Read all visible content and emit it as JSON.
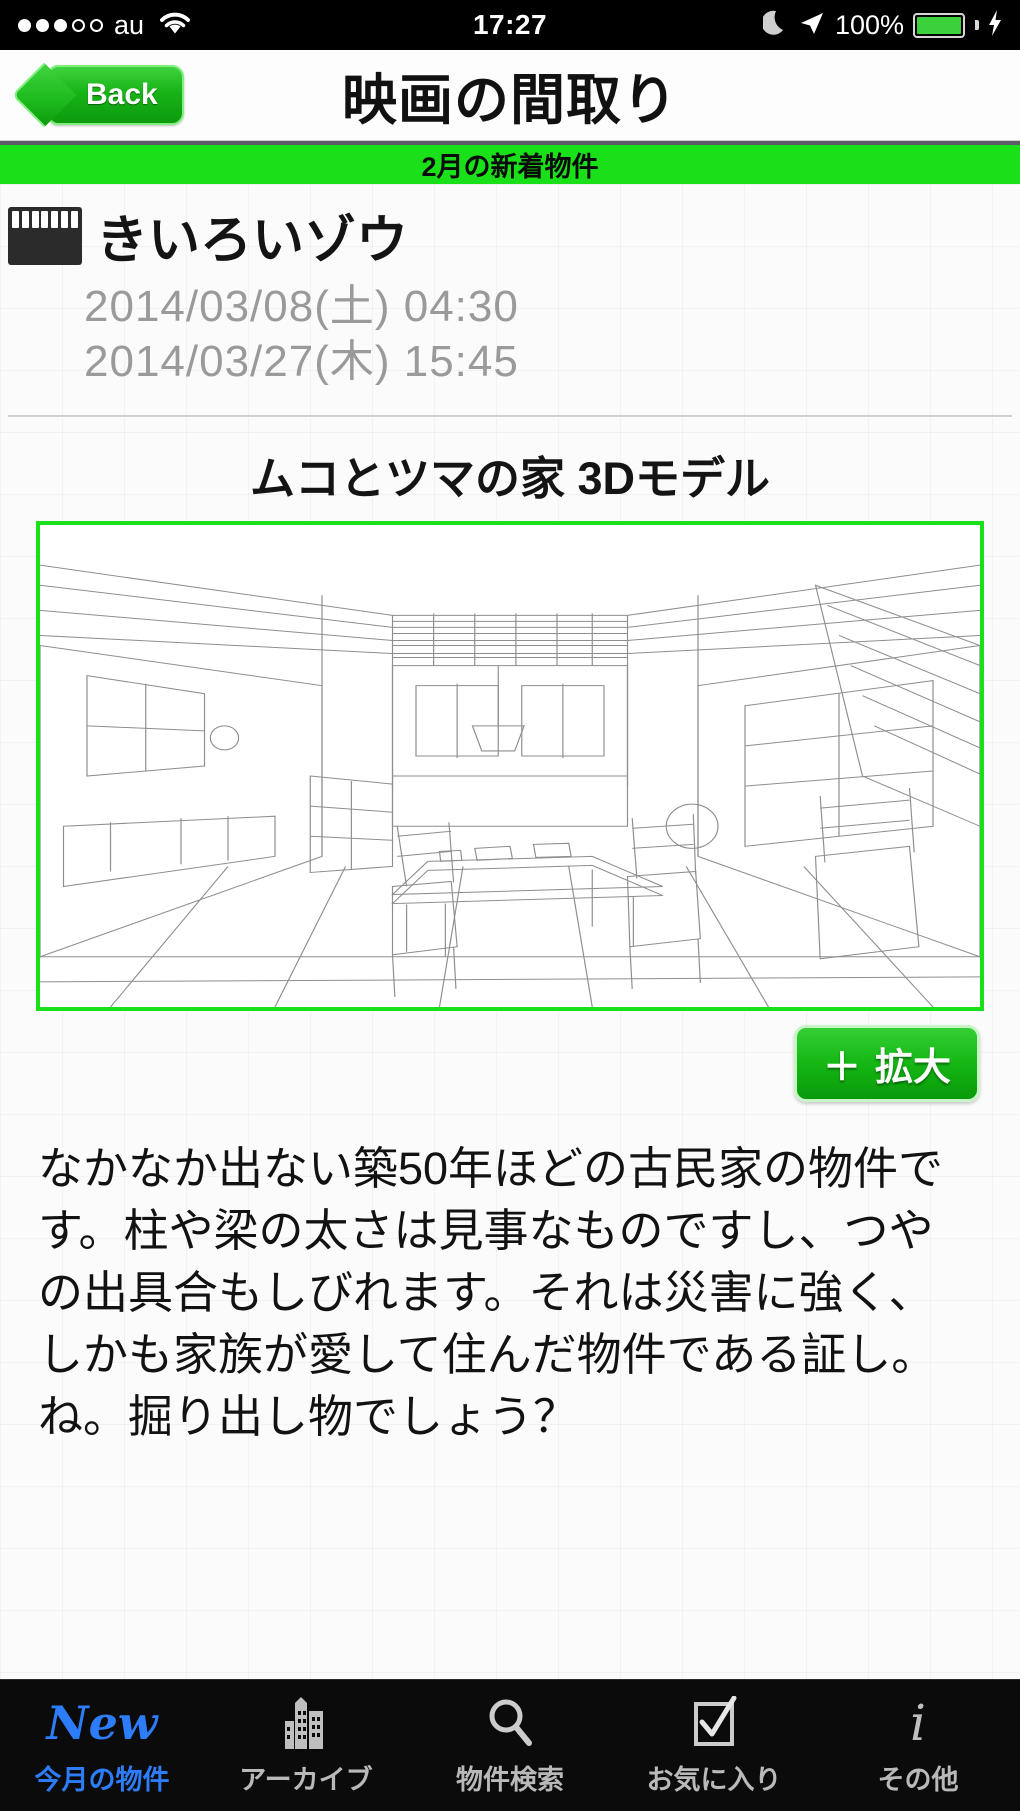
{
  "statusbar": {
    "signal_dots_filled": 3,
    "signal_dots_empty": 2,
    "carrier": "au",
    "wifi_icon": "wifi-icon",
    "time": "17:27",
    "dnd_icon": "moon-icon",
    "location_icon": "location-arrow-icon",
    "battery_percent": "100%",
    "battery_icon": "battery-charging-icon",
    "bolt": "⚡",
    "battery_color": "#3bd13b"
  },
  "navbar": {
    "back_label": "Back",
    "back_icon": "chevron-left-icon",
    "title": "映画の間取り",
    "accent_color": "#19e019"
  },
  "banner": {
    "label": "2月の新着物件",
    "background": "#19e019"
  },
  "movie": {
    "icon": "film-strip-icon",
    "title": "きいろいゾウ",
    "dates": [
      "2014/03/08(土) 04:30",
      "2014/03/27(木) 15:45"
    ]
  },
  "model_section": {
    "title": "ムコとツマの家 3Dモデル",
    "image_alt": "3d-floorplan-interior-line-drawing",
    "frame_color": "#19e019",
    "zoom_button": {
      "plus": "＋",
      "label": "拡大",
      "icon": "plus-icon"
    }
  },
  "description": {
    "lines": [
      "なかなか出ない築50年ほどの古民家の物件で",
      "す。柱や梁の太さは見事なものですし、つや",
      "の出具合もしびれます。それは災害に強く、",
      "しかも家族が愛して住んだ物件である証し。",
      "ね。掘り出し物でしょう？"
    ]
  },
  "tabbar": {
    "active_color": "#2d7dfa",
    "inactive_color": "#b9b9b9",
    "items": [
      {
        "label": "今月の物件",
        "icon": "new-badge-icon",
        "glyph": "New",
        "active": true
      },
      {
        "label": "アーカイブ",
        "icon": "buildings-icon",
        "active": false
      },
      {
        "label": "物件検索",
        "icon": "search-icon",
        "active": false
      },
      {
        "label": "お気に入り",
        "icon": "checkbox-checked-icon",
        "active": false
      },
      {
        "label": "その他",
        "icon": "info-icon",
        "glyph": "i",
        "active": false
      }
    ]
  }
}
